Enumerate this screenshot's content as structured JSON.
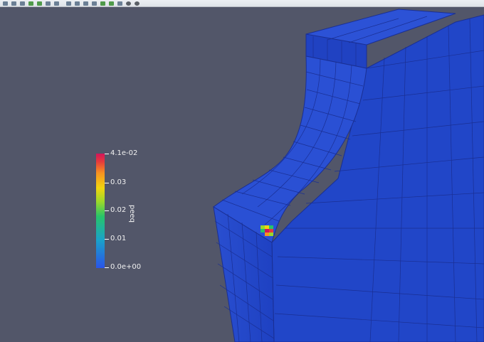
{
  "toolbar": {
    "buttons": [
      {
        "icon": "reset-camera-icon",
        "style": "blue"
      },
      {
        "icon": "zoom-to-data-icon",
        "style": "blue"
      },
      {
        "icon": "zoom-closest-icon",
        "style": "blue"
      },
      {
        "icon": "camera-undo-icon",
        "style": "green"
      },
      {
        "icon": "camera-redo-icon",
        "style": "green"
      },
      {
        "icon": "rotate-90-icon",
        "style": "blue"
      },
      {
        "icon": "view-axis-x-icon",
        "style": "blue"
      },
      {
        "icon": "view-axis-y-icon",
        "style": "blue"
      },
      {
        "icon": "view-axis-z-icon",
        "style": "blue"
      },
      {
        "icon": "select-cells-icon",
        "style": "blue"
      },
      {
        "icon": "select-points-icon",
        "style": "blue"
      },
      {
        "icon": "select-frustum-icon",
        "style": "green"
      },
      {
        "icon": "interactive-select-icon",
        "style": "green"
      },
      {
        "icon": "grow-selection-icon",
        "style": "blue"
      },
      {
        "icon": "shrink-selection-icon",
        "style": "dark"
      },
      {
        "icon": "clear-selection-icon",
        "style": "dark"
      }
    ]
  },
  "colorbar": {
    "title": "peeq",
    "labels": [
      "4.1e-02",
      "0.03",
      "0.02",
      "0.01",
      "0.0e+00"
    ],
    "levels": [
      0.041,
      0.03,
      0.02,
      0.01,
      0.0
    ],
    "range": [
      0.0,
      0.041
    ]
  },
  "colors": {
    "background": "#525669",
    "mesh_fill": "#2347c9",
    "mesh_edge": "#1a2f93",
    "hotspot": [
      "#d3155b",
      "#f2d50e",
      "#27c46a",
      "#9cd82a"
    ]
  }
}
